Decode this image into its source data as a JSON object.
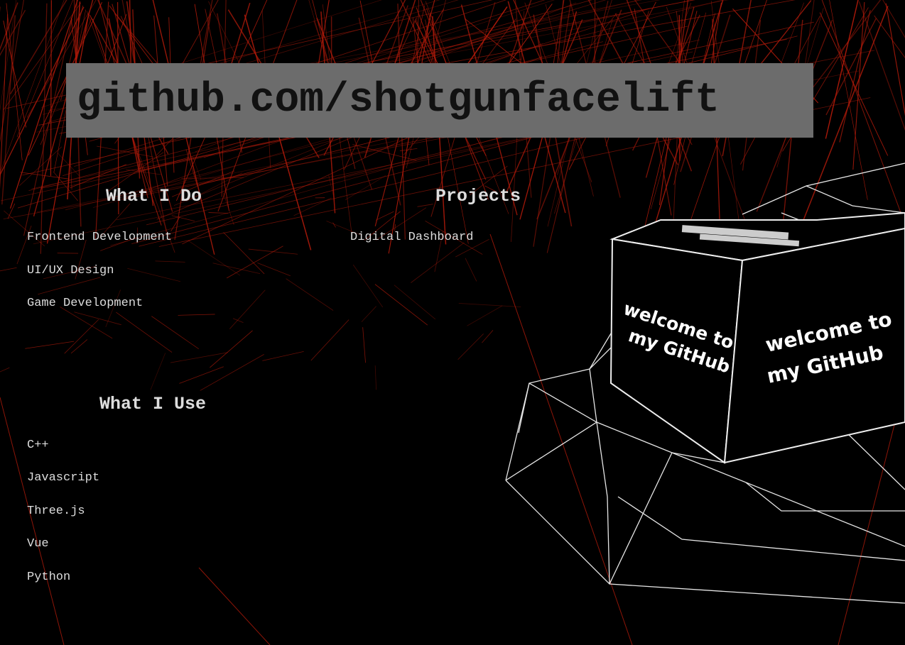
{
  "header": {
    "title": "github.com/shotgunfacelift"
  },
  "what_i_do": {
    "heading": "What I Do",
    "items": [
      "Frontend Development",
      "UI/UX Design",
      "Game Development"
    ]
  },
  "projects": {
    "heading": "Projects",
    "items": [
      "Digital Dashboard"
    ]
  },
  "what_i_use": {
    "heading": "What I Use",
    "items": [
      "C++",
      "Javascript",
      "Three.js",
      "Vue",
      "Python"
    ]
  },
  "cube": {
    "left_face_line1": "welcome to",
    "left_face_line2": "my GitHub",
    "right_face_line1": "welcome to",
    "right_face_line2": "my GitHub"
  },
  "colors": {
    "background": "#000000",
    "title_bar": "#6c6c6c",
    "wireframe_red": "#b01a0a",
    "wireframe_white": "#e6e6e6"
  }
}
